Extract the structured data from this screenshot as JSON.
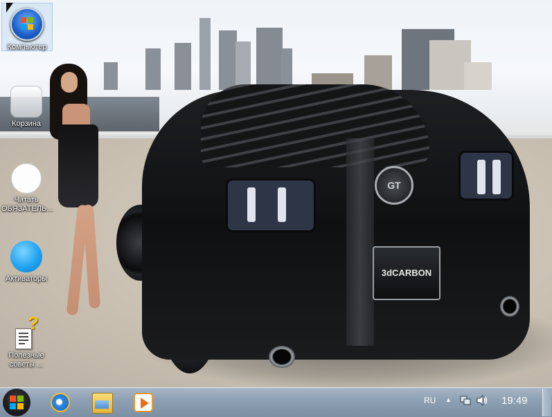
{
  "desktop": {
    "icons": [
      {
        "label": "Компьютер",
        "icon": "computer-icon"
      },
      {
        "label": "Корзина",
        "icon": "recycle-bin-icon"
      },
      {
        "label": "Читать ОБЯЗАТЕЛЬ...",
        "icon": "read-first-icon"
      },
      {
        "label": "Активаторы",
        "icon": "activators-icon"
      },
      {
        "label": "Полезные советы ...",
        "icon": "help-tips-icon"
      }
    ],
    "wallpaper": {
      "plate_text": "3dCARBON",
      "badge_text": "GT"
    }
  },
  "taskbar": {
    "pinned": [
      "internet-explorer-icon",
      "windows-explorer-icon",
      "media-player-icon"
    ],
    "tray": {
      "language": "RU",
      "show_hidden": "▲",
      "clock": "19:49"
    }
  },
  "colors": {
    "taskbar": "#8ea0b3",
    "start_flag": [
      "#f25022",
      "#7fba00",
      "#00a4ef",
      "#ffb900"
    ]
  }
}
